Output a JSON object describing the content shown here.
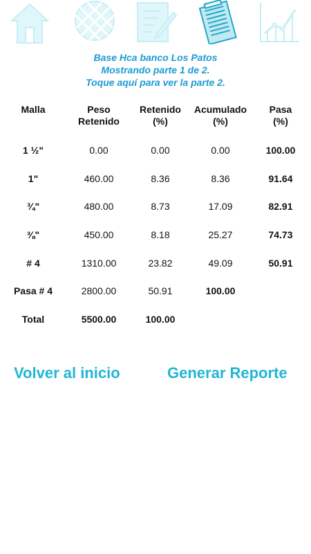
{
  "nav": {
    "icons": [
      "home-icon",
      "mesh-icon",
      "edit-icon",
      "list-icon",
      "chart-icon"
    ],
    "icon_color": "#dff6fa",
    "icon_stroke": "#c6eef5"
  },
  "header": {
    "line1": "Base Hca banco Los Patos",
    "line2": "Mostrando parte 1 de 2.",
    "line3": "Toque aquí para ver la parte 2.",
    "color": "#1c9ad6"
  },
  "table": {
    "headers": {
      "malla": "Malla",
      "peso1": "Peso",
      "peso2": "Retenido",
      "ret1": "Retenido",
      "ret2": "(%)",
      "acum1": "Acumulado",
      "acum2": "(%)",
      "pasa1": "Pasa",
      "pasa2": "(%)"
    },
    "rows": [
      {
        "malla": "1 ½\"",
        "peso": "0.00",
        "retenido": "0.00",
        "acumulado": "0.00",
        "pasa": "100.00"
      },
      {
        "malla": "1\"",
        "peso": "460.00",
        "retenido": "8.36",
        "acumulado": "8.36",
        "pasa": "91.64"
      },
      {
        "malla": "¾\"",
        "peso": "480.00",
        "retenido": "8.73",
        "acumulado": "17.09",
        "pasa": "82.91"
      },
      {
        "malla": "⅜\"",
        "peso": "450.00",
        "retenido": "8.18",
        "acumulado": "25.27",
        "pasa": "74.73"
      },
      {
        "malla": "# 4",
        "peso": "1310.00",
        "retenido": "23.82",
        "acumulado": "49.09",
        "pasa": "50.91"
      },
      {
        "malla": "Pasa # 4",
        "peso": "2800.00",
        "retenido": "50.91",
        "acumulado": "100.00",
        "pasa": ""
      }
    ],
    "total": {
      "label": "Total",
      "peso": "5500.00",
      "retenido": "100.00"
    }
  },
  "buttons": {
    "home": "Volver al inicio",
    "report": "Generar Reporte",
    "color": "#22b5d6"
  }
}
